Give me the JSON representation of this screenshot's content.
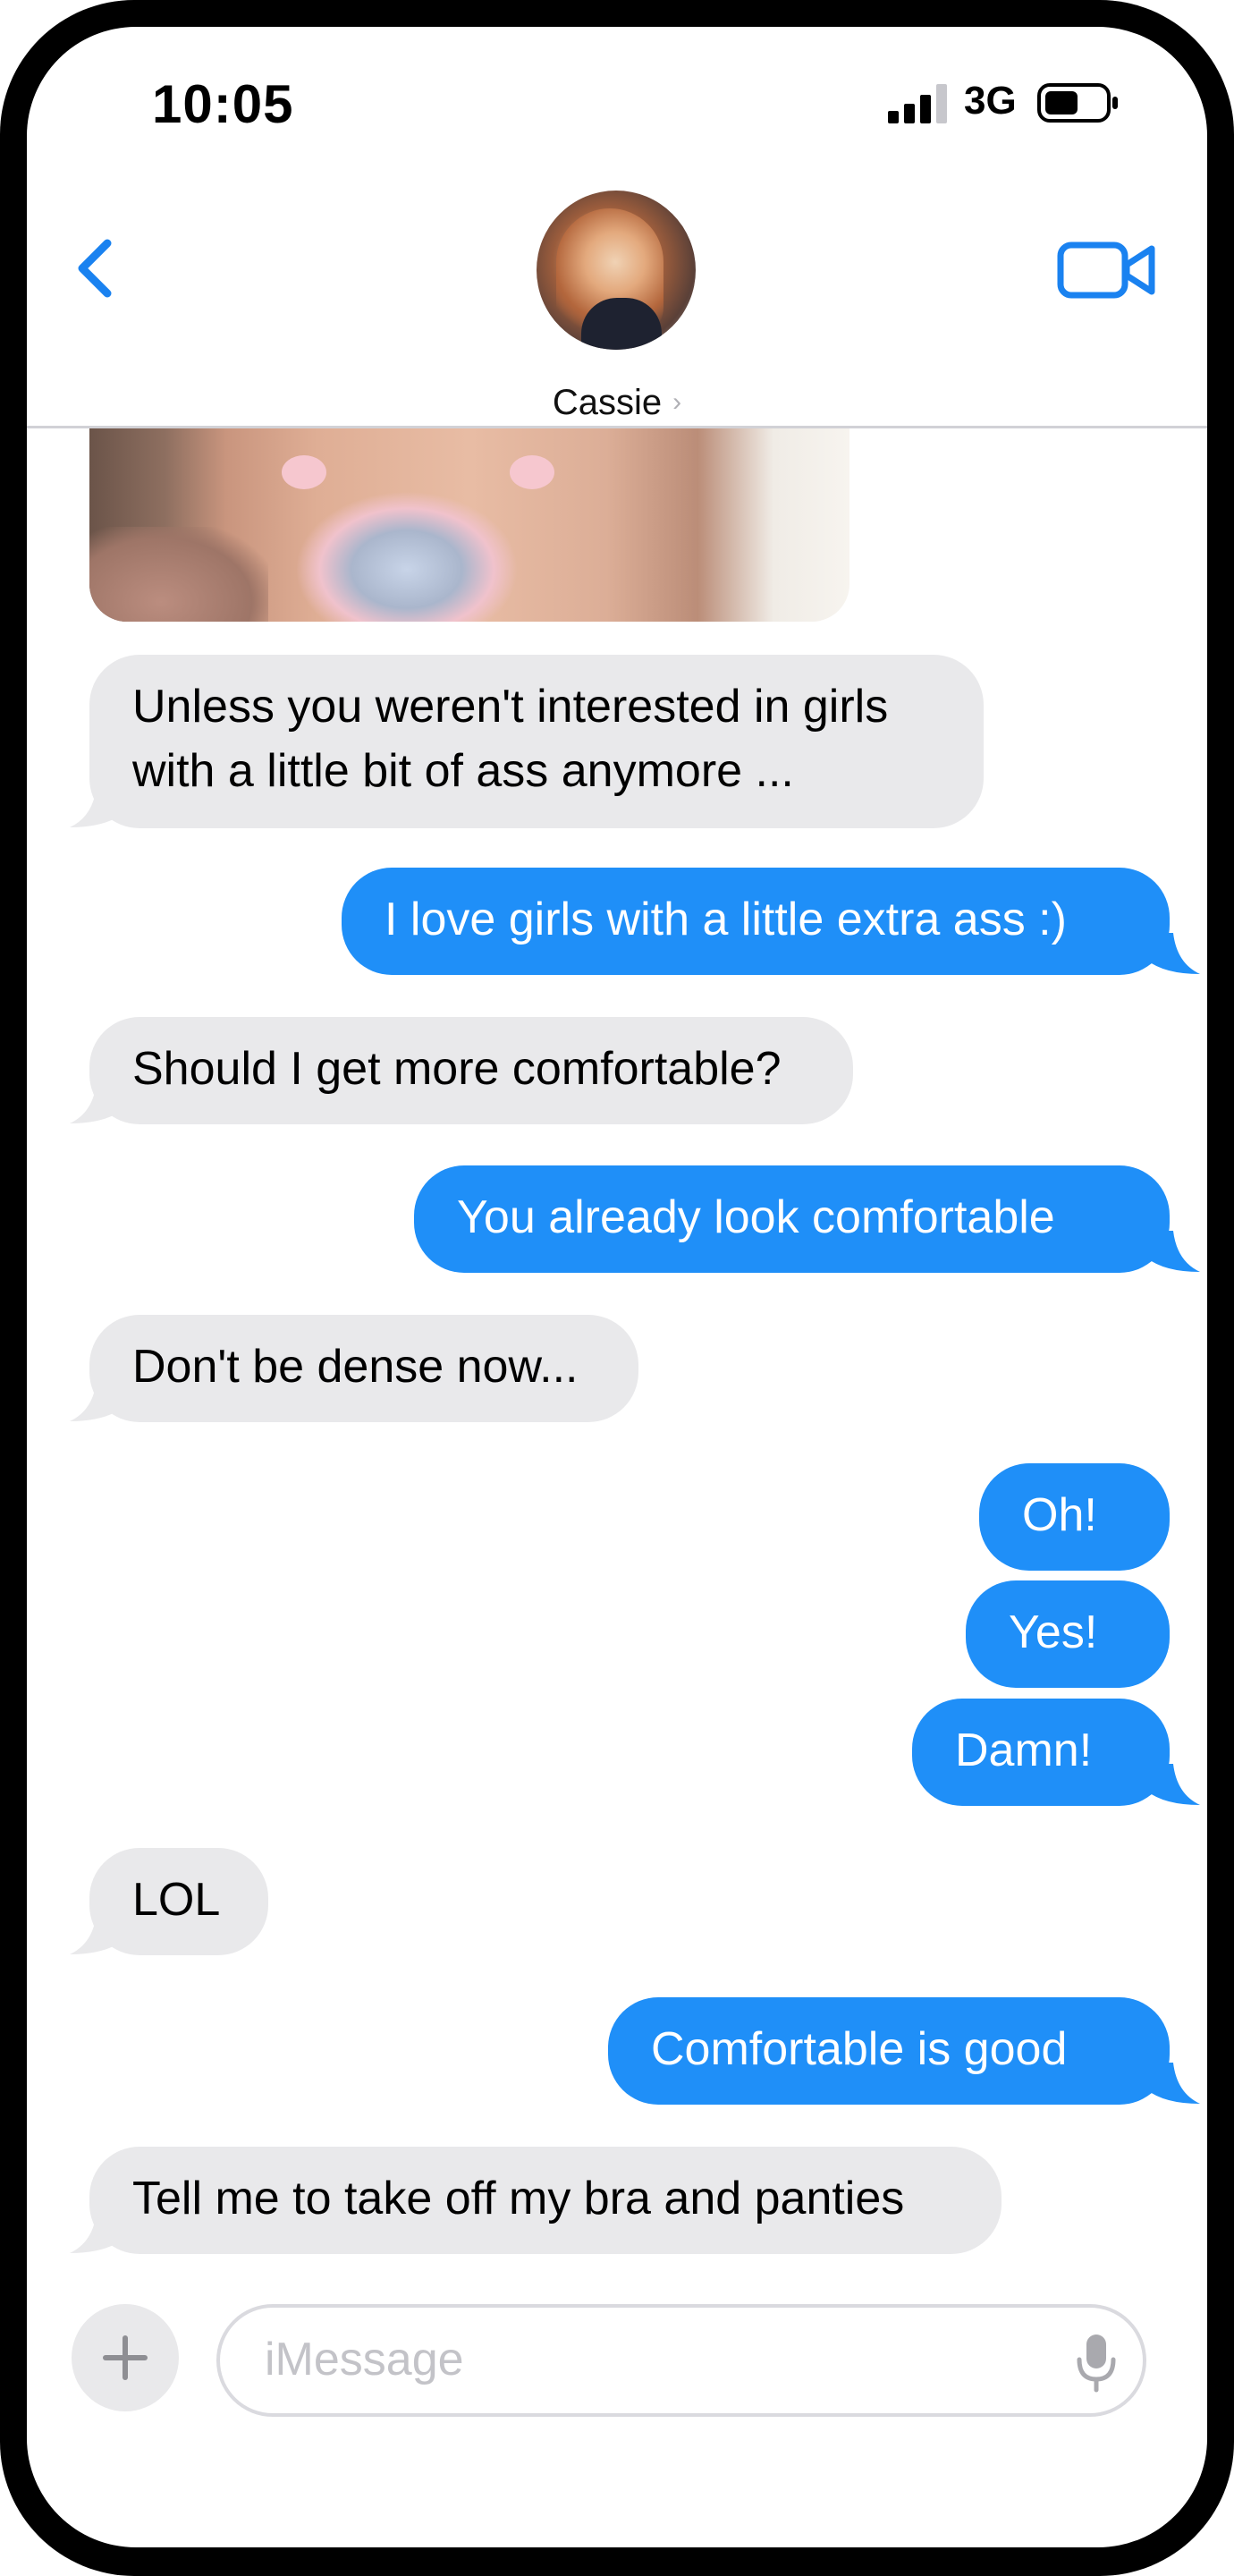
{
  "status_bar": {
    "time": "10:05",
    "network": "3G",
    "signal_icon": "signal-bars-icon",
    "battery_icon": "battery-icon"
  },
  "header": {
    "back_icon": "chevron-left-icon",
    "video_icon": "video-camera-icon",
    "contact_name": "Cassie",
    "contact_chevron": "›"
  },
  "messages": [
    {
      "from": "them",
      "type": "image"
    },
    {
      "from": "them",
      "lines": [
        "Unless you weren't interested in girls",
        "with a little bit of ass anymore ..."
      ]
    },
    {
      "from": "me",
      "lines": [
        "I love girls with a little extra ass :)"
      ]
    },
    {
      "from": "them",
      "lines": [
        "Should I get more comfortable?"
      ]
    },
    {
      "from": "me",
      "lines": [
        "You already look comfortable"
      ]
    },
    {
      "from": "them",
      "lines": [
        "Don't be dense now..."
      ]
    },
    {
      "from": "me",
      "lines": [
        "Oh!"
      ]
    },
    {
      "from": "me",
      "lines": [
        "Yes!"
      ]
    },
    {
      "from": "me",
      "lines": [
        "Damn!"
      ]
    },
    {
      "from": "them",
      "lines": [
        "LOL"
      ]
    },
    {
      "from": "me",
      "lines": [
        "Comfortable is good"
      ]
    },
    {
      "from": "them",
      "lines": [
        "Tell me to take off my bra and panties"
      ]
    }
  ],
  "composer": {
    "plus_label": "+",
    "placeholder": "iMessage",
    "mic_icon": "microphone-icon"
  },
  "colors": {
    "outgoing_bubble": "#1f8ff8",
    "incoming_bubble": "#e9e9eb",
    "accent": "#1a82f0"
  }
}
